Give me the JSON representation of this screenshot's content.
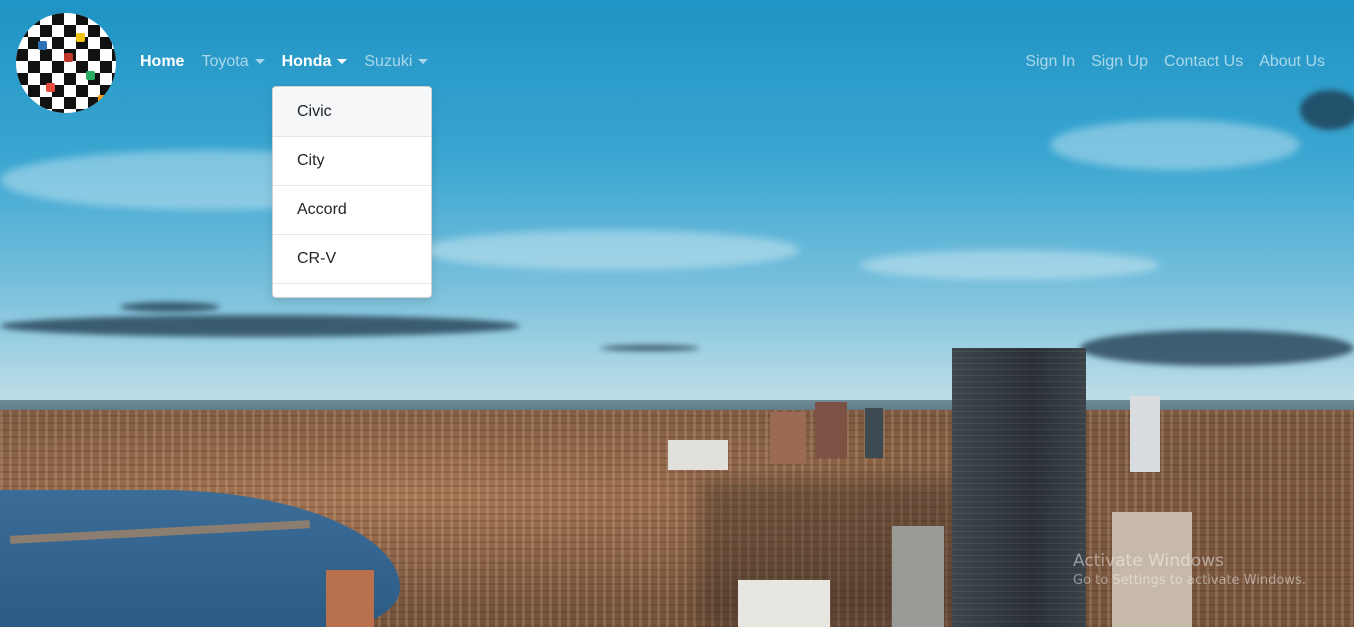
{
  "navbar": {
    "logo_alt": "car brands logo",
    "links_left": [
      {
        "label": "Home",
        "active": true,
        "dropdown": false
      },
      {
        "label": "Toyota",
        "active": false,
        "dropdown": true
      },
      {
        "label": "Honda",
        "active": true,
        "dropdown": true
      },
      {
        "label": "Suzuki",
        "active": false,
        "dropdown": true
      }
    ],
    "links_right": [
      {
        "label": "Sign In"
      },
      {
        "label": "Sign Up"
      },
      {
        "label": "Contact Us"
      },
      {
        "label": "About Us"
      }
    ]
  },
  "honda_dropdown": {
    "items": [
      "Civic",
      "City",
      "Accord",
      "CR-V"
    ]
  },
  "watermark": {
    "line1": "Activate Windows",
    "line2": "Go to Settings to activate Windows."
  },
  "colors": {
    "sky": "#2c9bc6",
    "nav_text": "#ffffff",
    "dropdown_bg": "#ffffff"
  }
}
